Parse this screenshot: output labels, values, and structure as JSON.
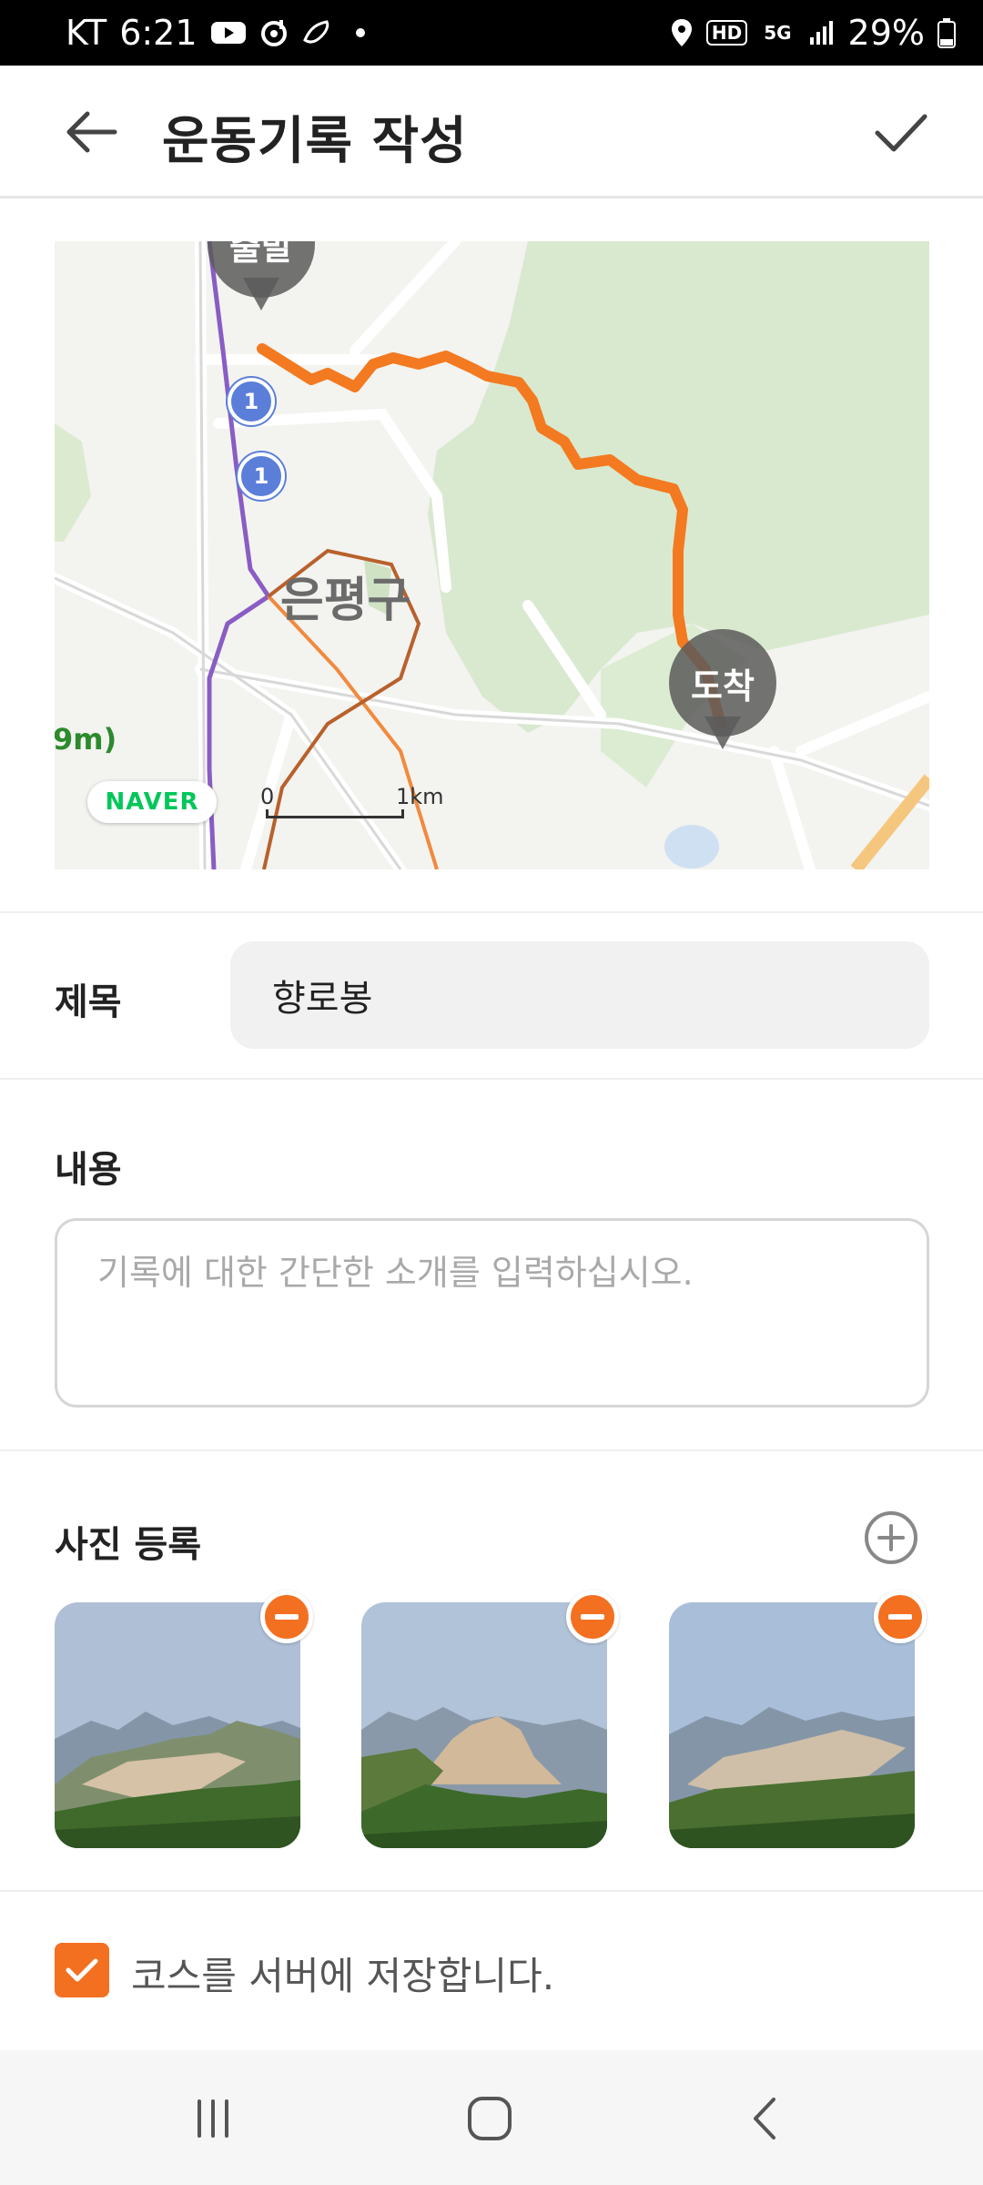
{
  "status_bar": {
    "carrier": "KT",
    "time": "6:21",
    "network": "5G",
    "hd_label": "HD",
    "battery": "29%"
  },
  "header": {
    "title": "운동기록 작성"
  },
  "map": {
    "start_label": "출발",
    "end_label": "도착",
    "district_label": "은평구",
    "route_number": "1",
    "provider_logo": "NAVER",
    "scale_start": "0",
    "scale_end": "1km",
    "edge_text": "9m)",
    "route_color": "#f37a21"
  },
  "form": {
    "title_label": "제목",
    "title_value": "향로봉",
    "content_label": "내용",
    "content_placeholder": "기록에 대한 간단한 소개를 입력하십시오.",
    "photo_label": "사진 등록",
    "photos": [
      {
        "name": "mountain-photo-1"
      },
      {
        "name": "mountain-photo-2"
      },
      {
        "name": "mountain-photo-3"
      }
    ],
    "save_course_label": "코스를 서버에 저장합니다.",
    "save_course_checked": true
  },
  "colors": {
    "accent": "#f37021",
    "header_text": "#222222"
  },
  "icons": {
    "back": "arrow-left-icon",
    "confirm": "check-icon",
    "add_photo": "plus-circle-icon",
    "remove_photo": "minus-circle-icon",
    "nav_recent": "recent-apps-icon",
    "nav_home": "home-icon",
    "nav_back": "chevron-left-icon"
  }
}
